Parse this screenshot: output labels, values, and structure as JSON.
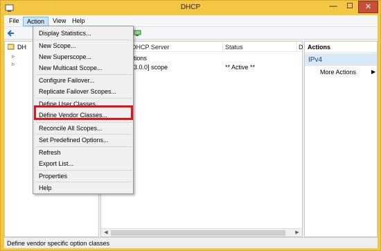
{
  "window": {
    "title": "DHCP"
  },
  "window_controls": {
    "minimize": "—",
    "maximize": "☐",
    "close": "✕"
  },
  "menubar": {
    "items": [
      "File",
      "Action",
      "View",
      "Help"
    ]
  },
  "tree": {
    "root_label": "DH"
  },
  "list": {
    "columns": [
      "DHCP Server",
      "Status",
      "D"
    ],
    "rows": [
      {
        "name": "tions",
        "status": ""
      },
      {
        "name": "3.0.0] scope",
        "status": "** Active **"
      }
    ]
  },
  "actions": {
    "title": "Actions",
    "section": "IPv4",
    "more": "More Actions"
  },
  "action_menu": {
    "items": [
      "Display Statistics...",
      "New Scope...",
      "New Superscope...",
      "New Multicast Scope...",
      "Configure Failover...",
      "Replicate Failover Scopes...",
      "Define User Classes...",
      "Define Vendor Classes...",
      "Reconcile All Scopes...",
      "Set Predefined Options...",
      "Refresh",
      "Export List...",
      "Properties",
      "Help"
    ],
    "highlighted": "Define Vendor Classes..."
  },
  "statusbar": {
    "text": "Define vendor specific option classes"
  },
  "colors": {
    "title_bar": "#f3c644",
    "highlight_box": "#e0131b",
    "close_button": "#c7503b"
  }
}
